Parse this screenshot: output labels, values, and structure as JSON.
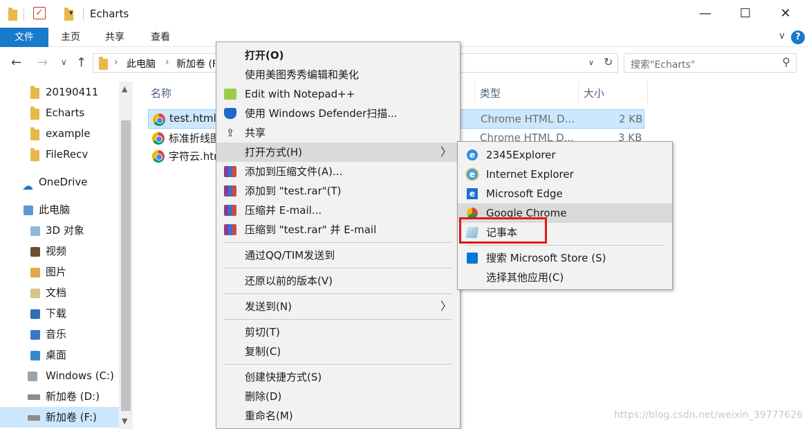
{
  "window": {
    "title": "Echarts",
    "minimize": "—",
    "maximize": "☐",
    "close": "✕"
  },
  "ribbon": {
    "tabs": [
      "文件",
      "主页",
      "共享",
      "查看"
    ],
    "help": "?",
    "expand": "∨"
  },
  "nav": {
    "back": "←",
    "forward": "→",
    "recent": "∨",
    "up": "↑",
    "breadcrumbs": [
      "此电脑",
      "新加卷 (F:)"
    ],
    "breadcrumb_sep": "›",
    "dropdown": "∨",
    "refresh": "↻",
    "search_placeholder": "搜索\"Echarts\""
  },
  "sidebar": {
    "items": [
      {
        "label": "20190411",
        "icon": "folder-icon"
      },
      {
        "label": "Echarts",
        "icon": "folder-icon"
      },
      {
        "label": "example",
        "icon": "folder-icon"
      },
      {
        "label": "FileRecv",
        "icon": "folder-icon"
      },
      {
        "label": "OneDrive",
        "icon": "cloud-icon"
      },
      {
        "label": "此电脑",
        "icon": "computer-icon"
      },
      {
        "label": "3D 对象",
        "icon": "3d-objects-icon"
      },
      {
        "label": "视频",
        "icon": "videos-icon"
      },
      {
        "label": "图片",
        "icon": "pictures-icon"
      },
      {
        "label": "文档",
        "icon": "documents-icon"
      },
      {
        "label": "下载",
        "icon": "downloads-icon"
      },
      {
        "label": "音乐",
        "icon": "music-icon"
      },
      {
        "label": "桌面",
        "icon": "desktop-icon"
      },
      {
        "label": "Windows (C:)",
        "icon": "windows-drive-icon"
      },
      {
        "label": "新加卷 (D:)",
        "icon": "drive-icon"
      },
      {
        "label": "新加卷 (F:)",
        "icon": "drive-icon"
      }
    ]
  },
  "filelist": {
    "columns": {
      "name": "名称",
      "type": "类型",
      "size": "大小"
    },
    "rows": [
      {
        "name": "test.html",
        "type": "Chrome HTML D...",
        "size": "2 KB"
      },
      {
        "name": "标准折线图",
        "type": "Chrome HTML D...",
        "size": "3 KB"
      },
      {
        "name": "字符云.html",
        "type": "",
        "size": ""
      }
    ]
  },
  "context_menu": {
    "items": [
      "打开(O)",
      "使用美图秀秀编辑和美化",
      "Edit with Notepad++",
      "使用 Windows Defender扫描...",
      "共享",
      "打开方式(H)",
      "添加到压缩文件(A)...",
      "添加到 \"test.rar\"(T)",
      "压缩并 E-mail...",
      "压缩到 \"test.rar\" 并 E-mail",
      "通过QQ/TIM发送到",
      "还原以前的版本(V)",
      "发送到(N)",
      "剪切(T)",
      "复制(C)",
      "创建快捷方式(S)",
      "删除(D)",
      "重命名(M)"
    ],
    "submenu_arrow": "〉"
  },
  "open_with_submenu": {
    "items": [
      "2345Explorer",
      "Internet Explorer",
      "Microsoft Edge",
      "Google Chrome",
      "记事本",
      "搜索 Microsoft Store (S)",
      "选择其他应用(C)"
    ]
  },
  "colors": {
    "accent": "#1979ca",
    "selection": "#cce8ff",
    "highlight_box": "#e0171b"
  },
  "watermark": "https://blog.csdn.net/weixin_39777626"
}
